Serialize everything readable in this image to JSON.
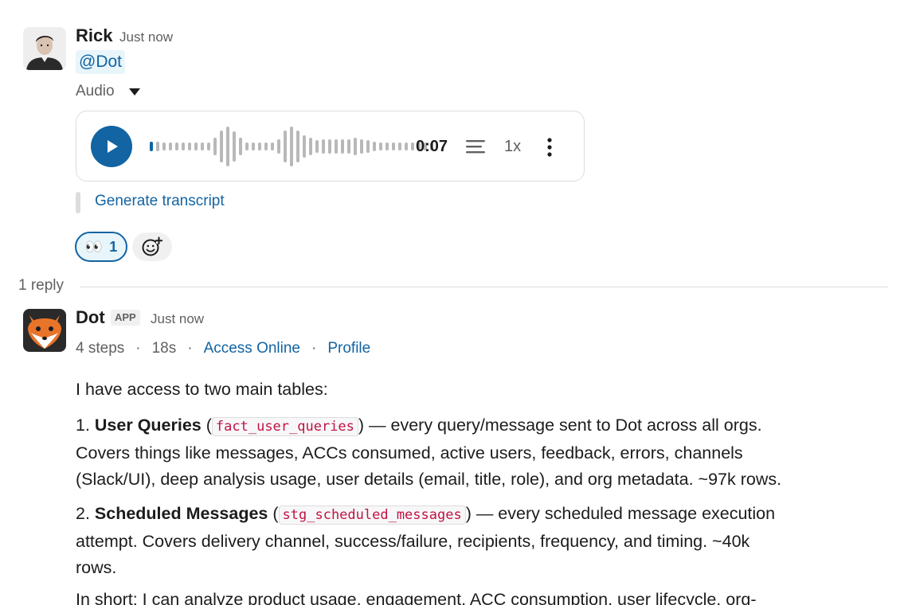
{
  "message": {
    "author": "Rick",
    "time": "Just now",
    "mention": "@Dot",
    "audio_label": "Audio",
    "audio": {
      "duration": "0:07",
      "speed": "1x",
      "progress_fraction": 0.0
    },
    "generate_transcript": "Generate transcript",
    "reactions": [
      {
        "emoji": "👀",
        "count": "1"
      }
    ]
  },
  "thread": {
    "reply_count": "1 reply"
  },
  "reply": {
    "author": "Dot",
    "badge": "APP",
    "time": "Just now",
    "meta": {
      "steps": "4 steps",
      "duration": "18s",
      "link1": "Access Online",
      "link2": "Profile"
    },
    "intro": "I have access to two main tables:",
    "items": [
      {
        "prefix": "1. ",
        "title": "User Queries",
        "code": "fact_user_queries",
        "after_code": ") — every query/message sent to Dot across all orgs.",
        "line2": "Covers things like messages, ACCs consumed, active users, feedback, errors, channels",
        "line3": "(Slack/UI), deep analysis usage, user details (email, title, role), and org metadata. ~97k rows."
      },
      {
        "prefix": "2. ",
        "title": "Scheduled Messages",
        "code": "stg_scheduled_messages",
        "after_code": ") — every scheduled message execution",
        "line2": "attempt. Covers delivery channel, success/failure, recipients, frequency, and timing. ~40k",
        "line3": "rows."
      }
    ],
    "summary": "In short: I can analyze product usage, engagement, ACC consumption, user lifecycle, org-"
  },
  "colors": {
    "link": "#1264a3",
    "accent_bg": "#e8f5fa",
    "code": "#c01343"
  }
}
